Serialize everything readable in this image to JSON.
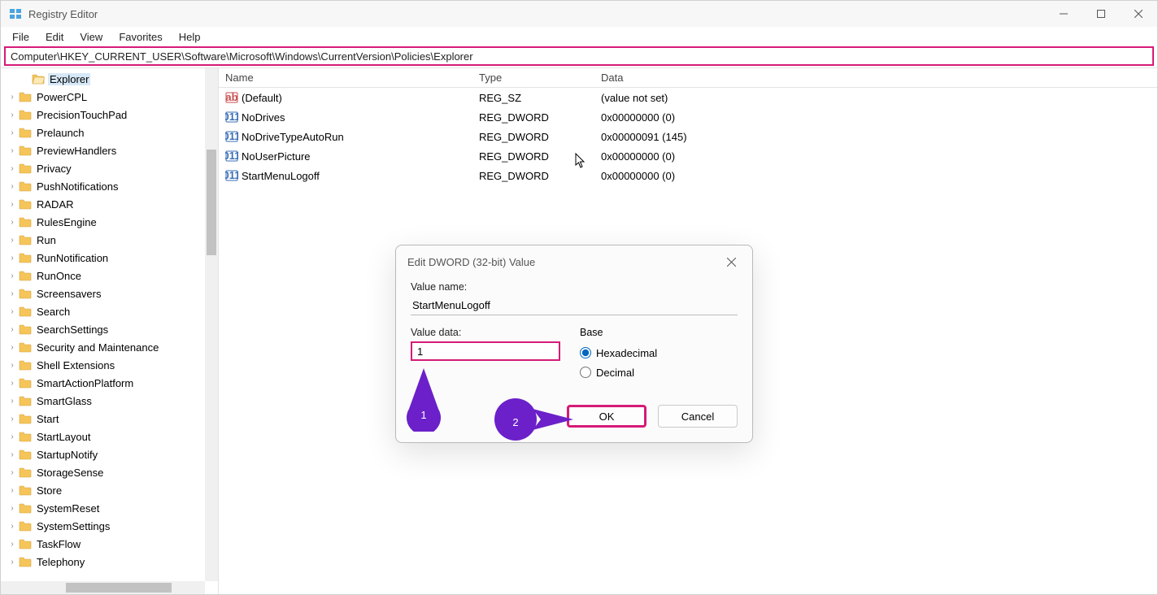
{
  "title": "Registry Editor",
  "menu": {
    "file": "File",
    "edit": "Edit",
    "view": "View",
    "favorites": "Favorites",
    "help": "Help"
  },
  "address": "Computer\\HKEY_CURRENT_USER\\Software\\Microsoft\\Windows\\CurrentVersion\\Policies\\Explorer",
  "tree": [
    {
      "label": "Explorer",
      "selected": true,
      "open": true
    },
    {
      "label": "PowerCPL"
    },
    {
      "label": "PrecisionTouchPad"
    },
    {
      "label": "Prelaunch"
    },
    {
      "label": "PreviewHandlers"
    },
    {
      "label": "Privacy"
    },
    {
      "label": "PushNotifications"
    },
    {
      "label": "RADAR"
    },
    {
      "label": "RulesEngine"
    },
    {
      "label": "Run"
    },
    {
      "label": "RunNotification"
    },
    {
      "label": "RunOnce"
    },
    {
      "label": "Screensavers"
    },
    {
      "label": "Search"
    },
    {
      "label": "SearchSettings"
    },
    {
      "label": "Security and Maintenance"
    },
    {
      "label": "Shell Extensions"
    },
    {
      "label": "SmartActionPlatform"
    },
    {
      "label": "SmartGlass"
    },
    {
      "label": "Start"
    },
    {
      "label": "StartLayout"
    },
    {
      "label": "StartupNotify"
    },
    {
      "label": "StorageSense"
    },
    {
      "label": "Store"
    },
    {
      "label": "SystemReset"
    },
    {
      "label": "SystemSettings"
    },
    {
      "label": "TaskFlow"
    },
    {
      "label": "Telephony"
    }
  ],
  "columns": {
    "name": "Name",
    "type": "Type",
    "data": "Data"
  },
  "rows": [
    {
      "icon": "sz",
      "name": "(Default)",
      "type": "REG_SZ",
      "data": "(value not set)"
    },
    {
      "icon": "dw",
      "name": "NoDrives",
      "type": "REG_DWORD",
      "data": "0x00000000 (0)"
    },
    {
      "icon": "dw",
      "name": "NoDriveTypeAutoRun",
      "type": "REG_DWORD",
      "data": "0x00000091 (145)"
    },
    {
      "icon": "dw",
      "name": "NoUserPicture",
      "type": "REG_DWORD",
      "data": "0x00000000 (0)"
    },
    {
      "icon": "dw",
      "name": "StartMenuLogoff",
      "type": "REG_DWORD",
      "data": "0x00000000 (0)"
    }
  ],
  "dialog": {
    "title": "Edit DWORD (32-bit) Value",
    "value_name_label": "Value name:",
    "value_name": "StartMenuLogoff",
    "value_data_label": "Value data:",
    "value_data": "1",
    "base_label": "Base",
    "hex": "Hexadecimal",
    "dec": "Decimal",
    "ok": "OK",
    "cancel": "Cancel"
  },
  "annotations": {
    "step1": "1",
    "step2": "2"
  }
}
